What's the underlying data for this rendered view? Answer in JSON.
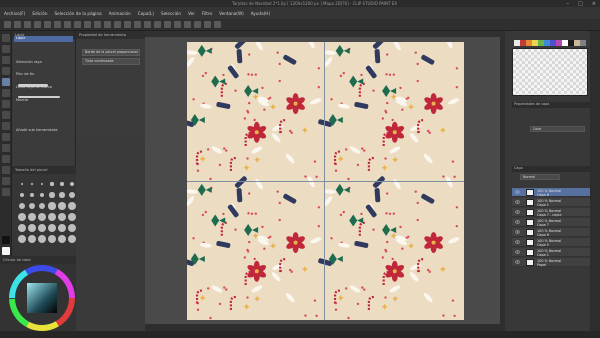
{
  "window": {
    "title": "Tarjetas de Navidad 2*1.lip [ 1200x1200 px ] Mapa 2D[?6] - CLIP STUDIO PAINT EX"
  },
  "menu": [
    "Archivo(F)",
    "Edición",
    "Selección de la página",
    "Animación",
    "Capa(L)",
    "Selección",
    "Ver",
    "Filtro",
    "Ventana(W)",
    "Ayuda(H)"
  ],
  "subtool": {
    "header": "Lápiz",
    "items": [
      {
        "label": "Lápiz",
        "selected": true
      },
      {
        "label": "Selección raya",
        "selected": false
      },
      {
        "label": "Pinc de tin",
        "selected": false
      },
      {
        "label": "Línea raya de marco",
        "selected": false
      },
      {
        "label": "Mezcla",
        "selected": false
      },
      {
        "label": "Añadir sub herramienta",
        "selected": false
      }
    ]
  },
  "toolprop": {
    "header": "Propiedad de herramienta",
    "fields": [
      "Borde de la pincel proporcional",
      "Tinta continuada"
    ]
  },
  "brushsize": {
    "header": "Tamaño del pincel"
  },
  "colorwheel": {
    "header": "Círculo de color"
  },
  "canvas": {
    "background": "#ecdcc2"
  },
  "rightpanel": {
    "swatch_colors": [
      "#e8e8e8",
      "#c23b3b",
      "#e58a2e",
      "#e9d64a",
      "#69b34a",
      "#3b8bd6",
      "#4f4fd0",
      "#b34ab3",
      "#ffffff",
      "#1c1c1c",
      "#c8b89a",
      "#808080"
    ],
    "property_header": "Propiedades de capa",
    "property_field": "Color",
    "layer_header": "Capa",
    "blend_label": "Normal",
    "layers": [
      {
        "name": "100 % Normal",
        "sub": "Capa 8",
        "selected": true
      },
      {
        "name": "100 % Normal",
        "sub": "Capa 1",
        "selected": false
      },
      {
        "name": "100 % Normal",
        "sub": "Capa 7 - copia",
        "selected": false
      },
      {
        "name": "100 % Normal",
        "sub": "Capa 7",
        "selected": false
      },
      {
        "name": "100 % Normal",
        "sub": "Capa 6",
        "selected": false
      },
      {
        "name": "100 % Normal",
        "sub": "Capa 5",
        "selected": false
      },
      {
        "name": "100 % Normal",
        "sub": "Capa 1",
        "selected": false
      },
      {
        "name": "100 % Normal",
        "sub": "Papel",
        "selected": false
      }
    ]
  },
  "pattern_colors": {
    "red": "#c0283a",
    "green": "#1f6b4e",
    "gold": "#e8b34a",
    "white": "#fbf6ee",
    "navy": "#2f3a5e",
    "dot": "#d94b5a"
  }
}
